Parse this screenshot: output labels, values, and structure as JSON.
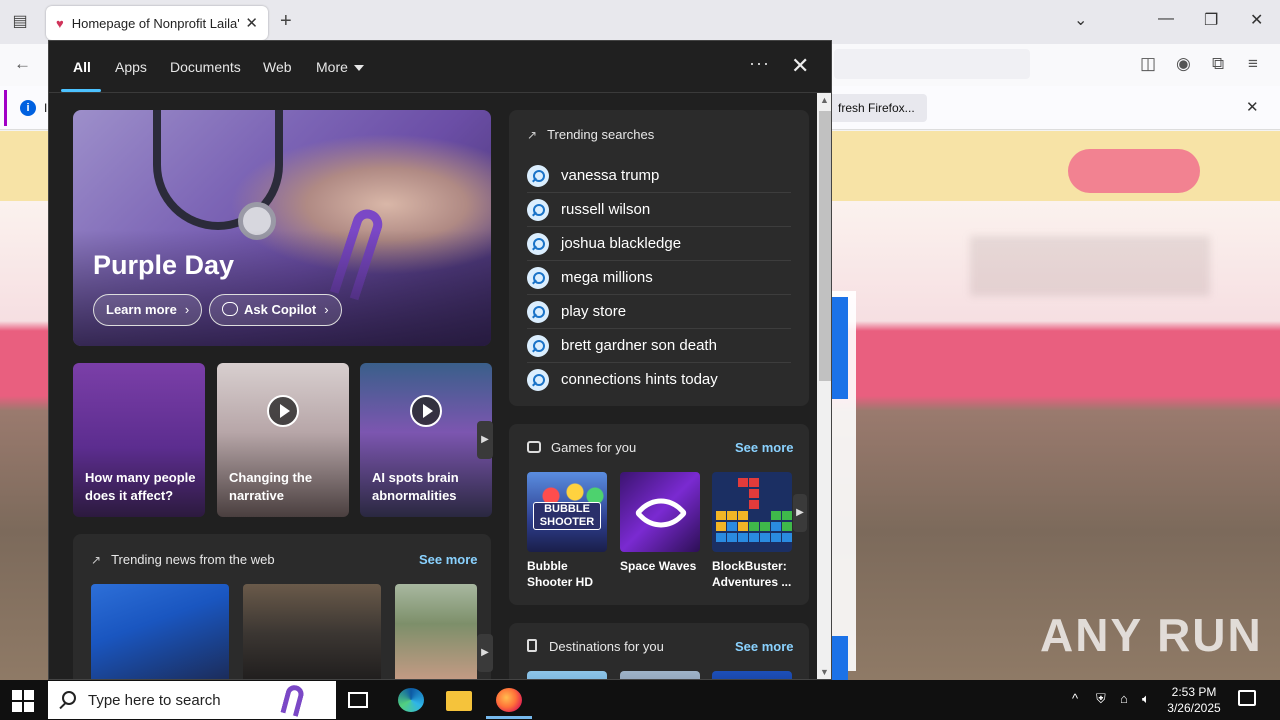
{
  "browser": {
    "tab_title": "Homepage of Nonprofit Laila's",
    "tab_close": "✕",
    "new_tab": "+",
    "window_controls": {
      "tabs_menu": "⌄",
      "minimize": "—",
      "restore": "❐",
      "close": "✕"
    },
    "info_bar": {
      "icon": "i",
      "text_fragment": "I",
      "refresh_button": "fresh Firefox...",
      "close": "✕"
    }
  },
  "flyout": {
    "tabs": [
      {
        "label": "All",
        "active": true
      },
      {
        "label": "Apps"
      },
      {
        "label": "Documents"
      },
      {
        "label": "Web"
      },
      {
        "label": "More"
      }
    ],
    "options_label": "···",
    "close_label": "✕",
    "hero": {
      "title": "Purple Day",
      "learn_more": "Learn more",
      "ask_copilot": "Ask Copilot",
      "chevron": "›"
    },
    "video_cards": [
      {
        "caption": "How many people does it affect?",
        "has_play": false
      },
      {
        "caption": "Changing the narrative",
        "has_play": true
      },
      {
        "caption": "AI spots brain abnormalities",
        "has_play": true
      }
    ],
    "carousel_next": "▶",
    "trending_searches": {
      "title": "Trending searches",
      "items": [
        "vanessa trump",
        "russell wilson",
        "joshua blackledge",
        "mega millions",
        "play store",
        "brett gardner son death",
        "connections hints today"
      ]
    },
    "trending_news": {
      "title": "Trending news from the web",
      "see_more": "See more"
    },
    "games": {
      "title": "Games for you",
      "see_more": "See more",
      "items": [
        {
          "name": "Bubble Shooter HD",
          "thumb_text": "BUBBLE SHOOTER"
        },
        {
          "name": "Space Waves"
        },
        {
          "name": "BlockBuster: Adventures ..."
        }
      ]
    },
    "destinations": {
      "title": "Destinations for you",
      "see_more": "See more"
    }
  },
  "taskbar": {
    "search_placeholder": "Type here to search",
    "time": "2:53 PM",
    "date": "3/26/2025",
    "tray_chevron": "^"
  },
  "watermark": "ANY RUN"
}
